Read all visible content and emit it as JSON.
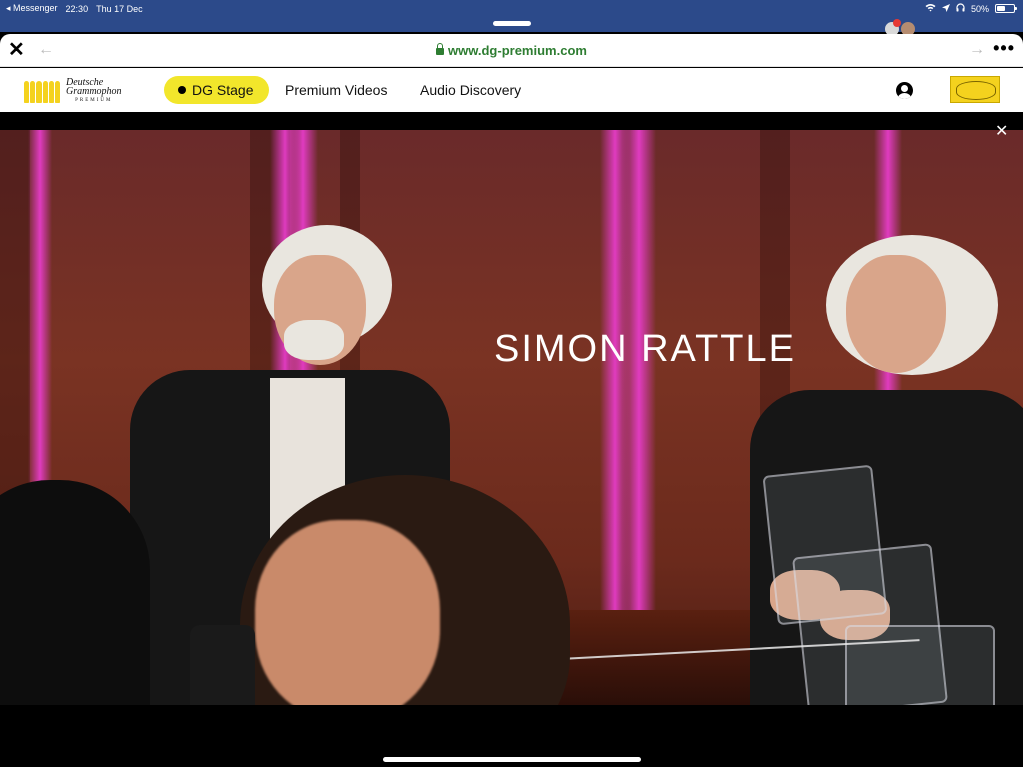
{
  "status_bar": {
    "back_app": "◂ Messenger",
    "time": "22:30",
    "date": "Thu 17 Dec",
    "battery": "50%",
    "battery_level": 0.5,
    "icons": [
      "wifi-icon",
      "location-icon",
      "headphones-icon",
      "battery-icon"
    ]
  },
  "browser": {
    "url": "www.dg-premium.com",
    "close_icon": "close-icon",
    "back_icon": "back-arrow-icon",
    "forward_icon": "forward-arrow-icon",
    "more_icon": "more-icon"
  },
  "site": {
    "brand_top": "Deutsche",
    "brand_main": "Grammophon",
    "brand_sub": "PREMIUM",
    "nav": [
      {
        "label": "DG Stage",
        "active": true
      },
      {
        "label": "Premium Videos",
        "active": false
      },
      {
        "label": "Audio Discovery",
        "active": false
      }
    ],
    "accent": "#f2e62b"
  },
  "video": {
    "caption": "SIMON RATTLE",
    "close_icon": "close-icon"
  }
}
